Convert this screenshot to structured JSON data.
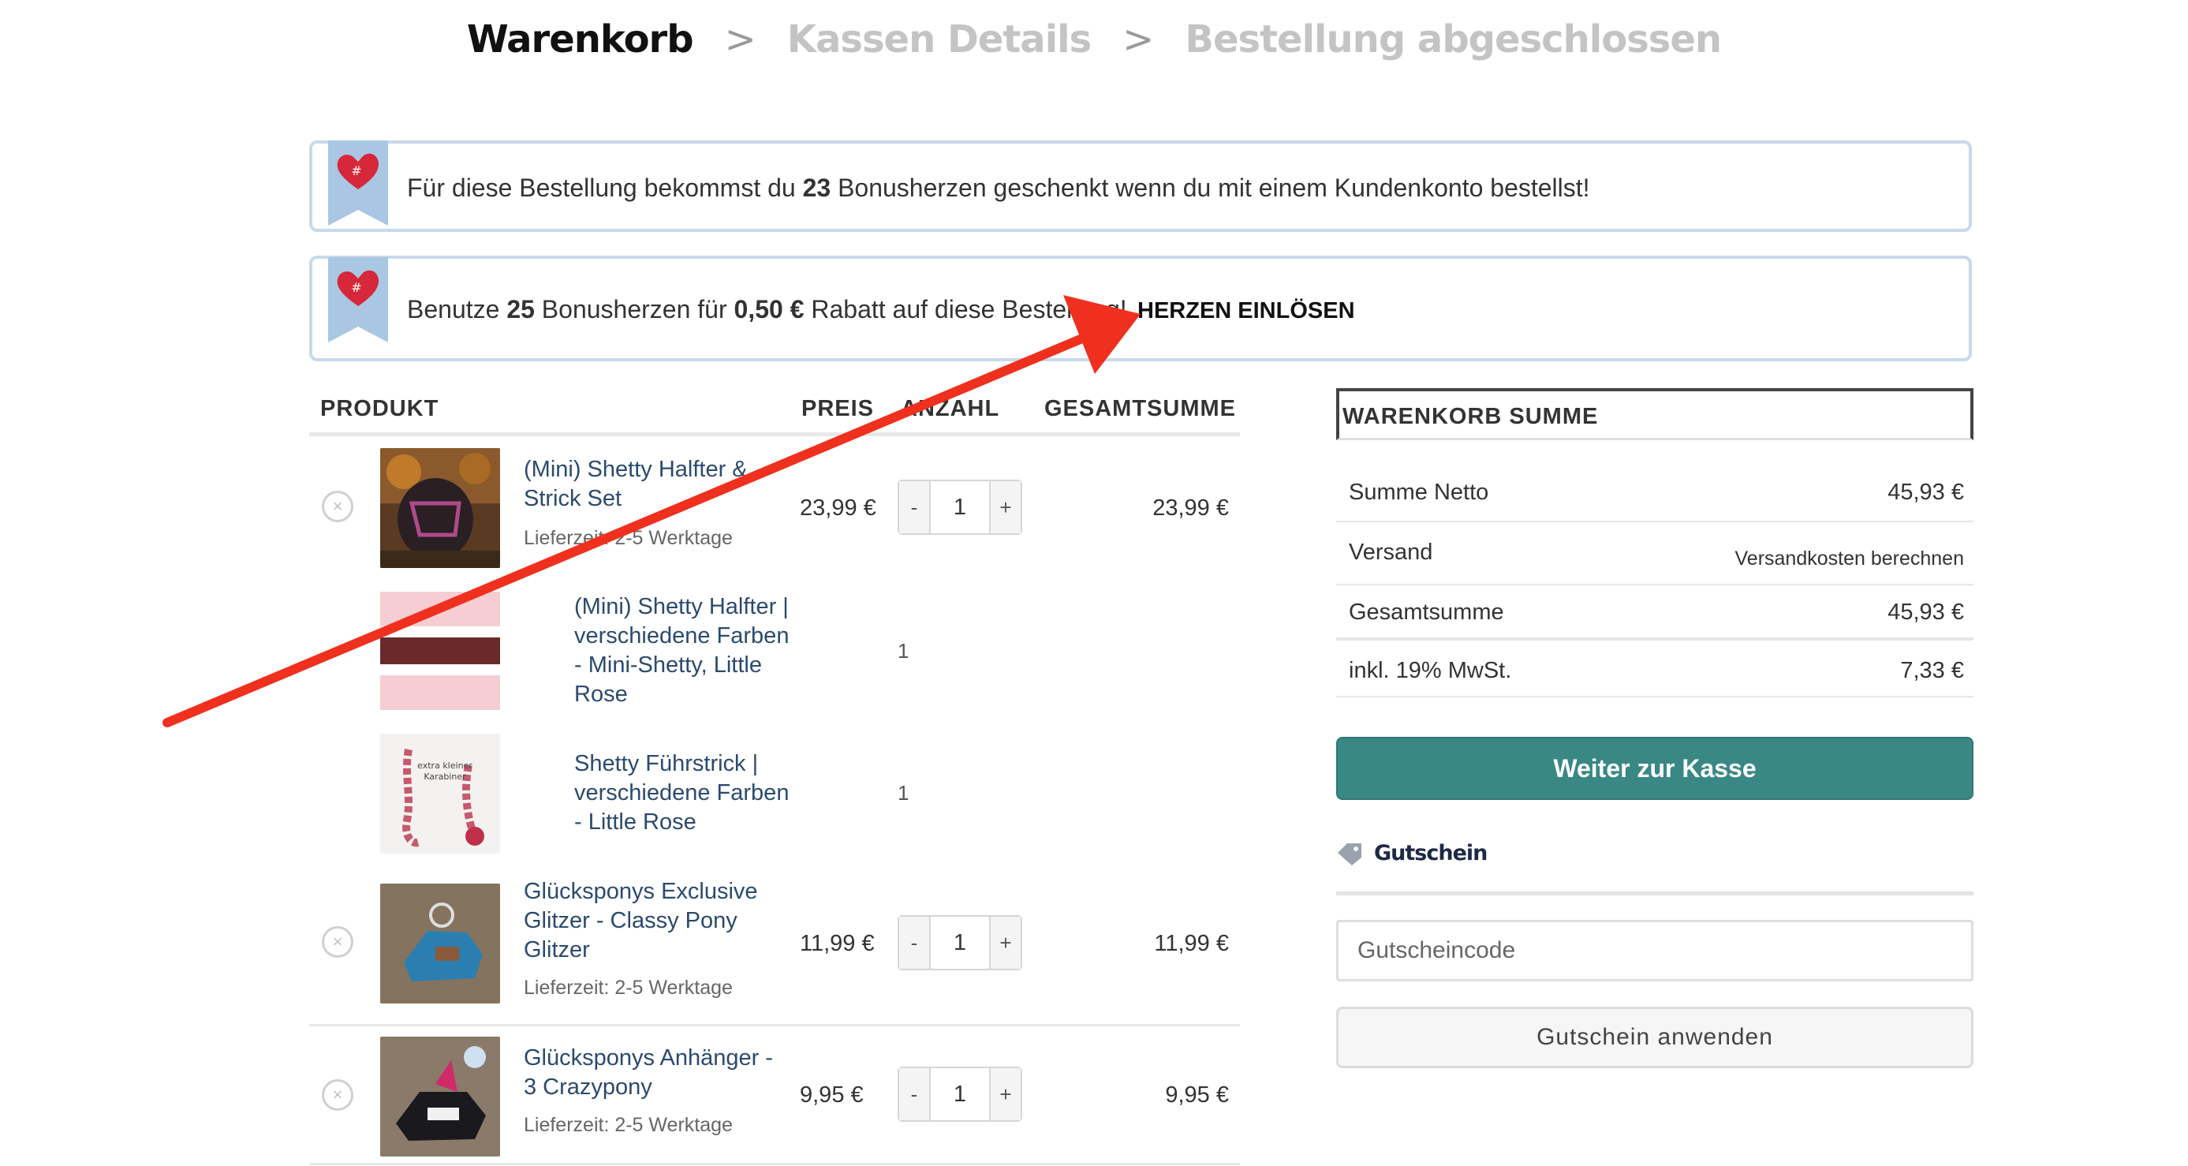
{
  "breadcrumb": {
    "step1": "Warenkorb",
    "step2": "Kassen Details",
    "step3": "Bestellung abgeschlossen",
    "separator": ">"
  },
  "notices": {
    "bonus_pre": "Für diese Bestellung bekommst du ",
    "bonus_count": "23",
    "bonus_post": " Bonusherzen geschenkt wenn du mit einem Kundenkonto bestellst!",
    "redeem_pre": "Benutze ",
    "redeem_count": "25",
    "redeem_mid": " Bonusherzen für ",
    "redeem_amount": "0,50 €",
    "redeem_post": " Rabatt auf diese Bestellung!",
    "redeem_link": "HERZEN EINLÖSEN",
    "ribbon_icon": "heart-ribbon-icon"
  },
  "table": {
    "headers": {
      "product": "PRODUKT",
      "price": "PREIS",
      "qty": "ANZAHL",
      "total": "GESAMTSUMME"
    },
    "items": [
      {
        "name": "(Mini) Shetty Halfter & Strick Set",
        "delivery": "Lieferzeit: 2-5 Werktage",
        "price": "23,99 €",
        "qty": "1",
        "total": "23,99 €"
      },
      {
        "name": "(Mini) Shetty Halfter | verschiedene Farben - Mini-Shetty, Little Rose",
        "qty": "1"
      },
      {
        "name": "Shetty Führstrick | verschiedene Farben - Little Rose",
        "qty": "1"
      },
      {
        "name": "Glücksponys Exclusive Glitzer - Classy Pony Glitzer",
        "delivery": "Lieferzeit: 2-5 Werktage",
        "price": "11,99 €",
        "qty": "1",
        "total": "11,99 €"
      },
      {
        "name": "Glücksponys Anhänger - 3 Crazypony",
        "delivery": "Lieferzeit: 2-5 Werktage",
        "price": "9,95 €",
        "qty": "1",
        "total": "9,95 €"
      }
    ],
    "minus": "-",
    "plus": "+",
    "remove": "×"
  },
  "totals": {
    "title": "WARENKORB SUMME",
    "rows": [
      {
        "label": "Summe Netto",
        "value": "45,93 €"
      },
      {
        "label": "Versand",
        "value": "Versandkosten berechnen"
      },
      {
        "label": "Gesamtsumme",
        "value": "45,93 €"
      },
      {
        "label": "inkl. 19% MwSt.",
        "value": "7,33 €"
      }
    ],
    "checkout": "Weiter zur Kasse"
  },
  "coupon": {
    "title": "Gutschein",
    "placeholder": "Gutscheincode",
    "apply": "Gutschein anwenden"
  },
  "colors": {
    "accent": "#3a8886",
    "notice_border": "#c8d9ea",
    "arrow": "#f0301e"
  }
}
